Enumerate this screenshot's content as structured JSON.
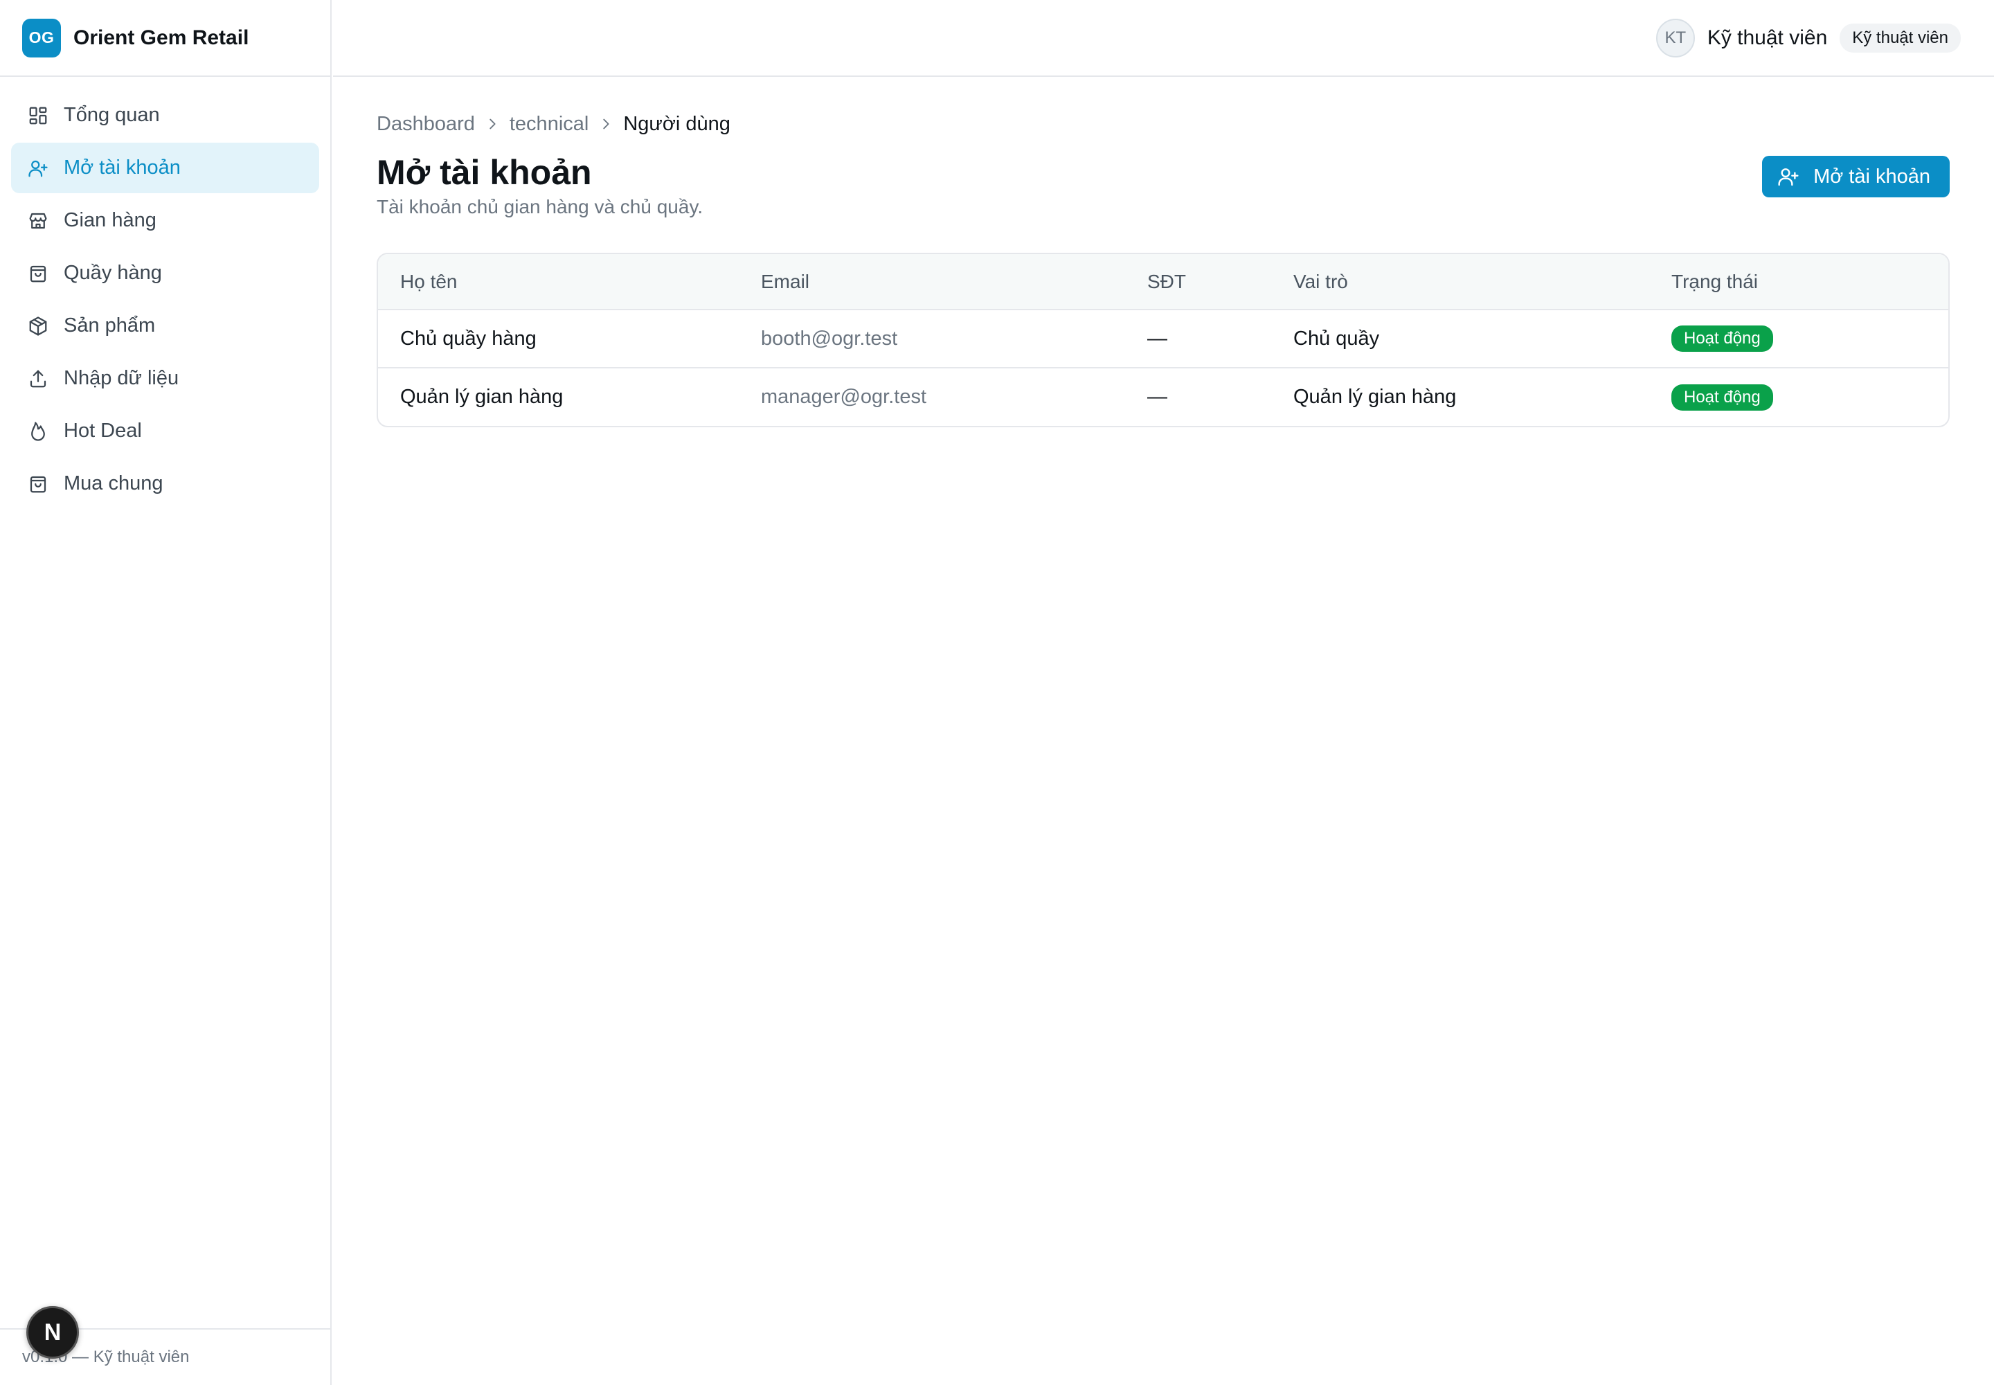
{
  "brand": {
    "logo": "OG",
    "name": "Orient Gem Retail"
  },
  "sidebar": {
    "items": [
      {
        "label": "Tổng quan",
        "icon": "dashboard-icon",
        "active": false
      },
      {
        "label": "Mở tài khoản",
        "icon": "user-plus-icon",
        "active": true
      },
      {
        "label": "Gian hàng",
        "icon": "store-icon",
        "active": false
      },
      {
        "label": "Quầy hàng",
        "icon": "shopping-bag-icon",
        "active": false
      },
      {
        "label": "Sản phẩm",
        "icon": "package-icon",
        "active": false
      },
      {
        "label": "Nhập dữ liệu",
        "icon": "upload-icon",
        "active": false
      },
      {
        "label": "Hot Deal",
        "icon": "flame-icon",
        "active": false
      },
      {
        "label": "Mua chung",
        "icon": "shopping-bag-icon",
        "active": false
      }
    ],
    "footer": "v0.1.0 — Kỹ thuật viên"
  },
  "header": {
    "avatar_initials": "KT",
    "user_name": "Kỹ thuật viên",
    "role_badge": "Kỹ thuật viên"
  },
  "breadcrumb": [
    "Dashboard",
    "technical",
    "Người dùng"
  ],
  "page": {
    "title": "Mở tài khoản",
    "subtitle": "Tài khoản chủ gian hàng và chủ quầy.",
    "primary_button": "Mở tài khoản"
  },
  "table": {
    "headers": [
      "Họ tên",
      "Email",
      "SĐT",
      "Vai trò",
      "Trạng thái"
    ],
    "rows": [
      {
        "name": "Chủ quầy hàng",
        "email": "booth@ogr.test",
        "phone": "—",
        "role": "Chủ quầy",
        "status": "Hoạt động"
      },
      {
        "name": "Quản lý gian hàng",
        "email": "manager@ogr.test",
        "phone": "—",
        "role": "Quản lý gian hàng",
        "status": "Hoạt động"
      }
    ]
  },
  "fab": {
    "label": "N"
  },
  "colors": {
    "accent": "#0b8ec6",
    "active_bg": "#e2f3fa",
    "status_green": "#0aa14a"
  }
}
